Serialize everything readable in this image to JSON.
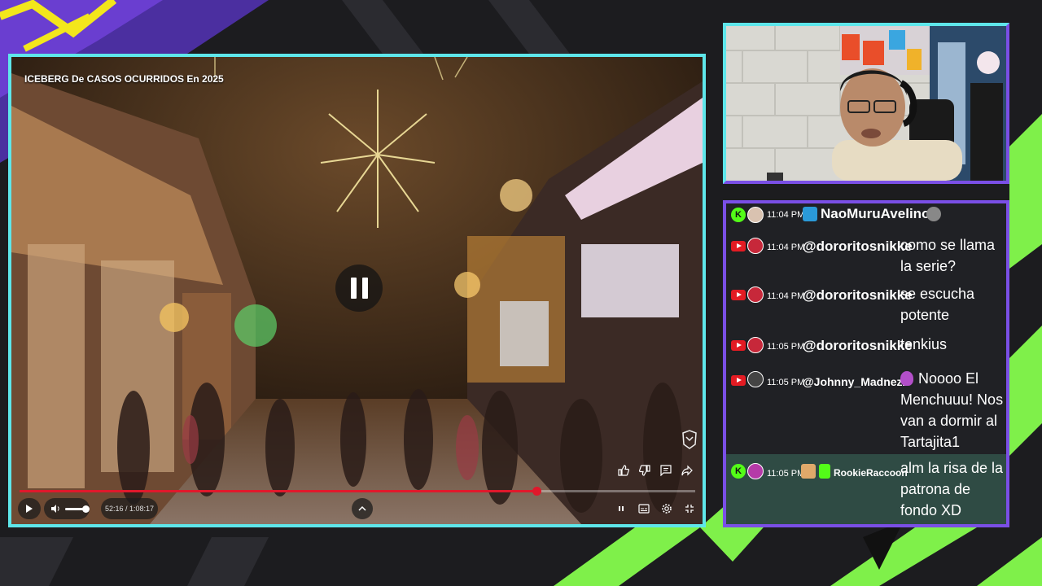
{
  "video": {
    "title": "ICEBERG De CASOS OCURRIDOS En 2025",
    "time_display": "52:16 / 1:08:17",
    "progress_fraction": 0.7655,
    "volume_fraction": 0.8
  },
  "chat": {
    "messages": [
      {
        "platform": "kick",
        "time": "11:04 PM",
        "username": "NaoMuruAvelino",
        "text": ""
      },
      {
        "platform": "youtube",
        "time": "11:04 PM",
        "username": "@dororitosnikke",
        "text": "como se llama la serie?"
      },
      {
        "platform": "youtube",
        "time": "11:04 PM",
        "username": "@dororitosnikke",
        "text": "se escucha potente"
      },
      {
        "platform": "youtube",
        "time": "11:05 PM",
        "username": "@dororitosnikke",
        "text": "tenkius"
      },
      {
        "platform": "youtube",
        "time": "11:05 PM",
        "username": "@Johnny_Madnezz",
        "text": "Noooo El Menchuuu! Nos van a dormir al Tartajita1"
      },
      {
        "platform": "kick",
        "time": "11:05 PM",
        "username": "RookieRaccoon",
        "text": "alm la risa de la patrona de fondo XD"
      }
    ]
  },
  "colors": {
    "frame_cyan": "#5ee6ea",
    "frame_purple": "#7a4fe6",
    "accent_green": "#7ff04a",
    "progress_red": "#e0182b",
    "kick_green": "#53fc18",
    "youtube_red": "#e31b23"
  }
}
